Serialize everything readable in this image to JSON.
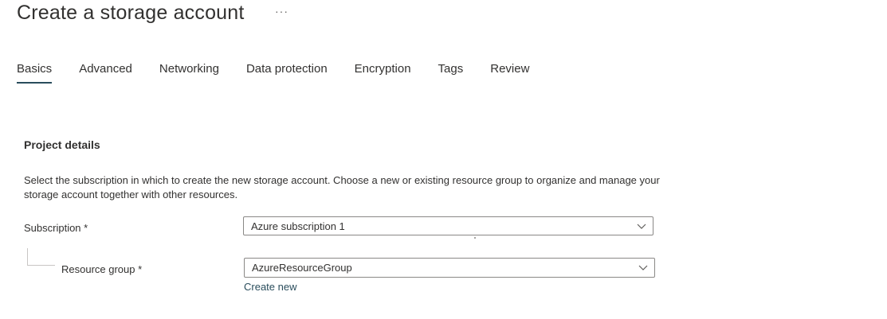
{
  "page": {
    "title": "Create a storage account",
    "more_label": "···"
  },
  "tabs": [
    {
      "label": "Basics",
      "active": true
    },
    {
      "label": "Advanced",
      "active": false
    },
    {
      "label": "Networking",
      "active": false
    },
    {
      "label": "Data protection",
      "active": false
    },
    {
      "label": "Encryption",
      "active": false
    },
    {
      "label": "Tags",
      "active": false
    },
    {
      "label": "Review",
      "active": false
    }
  ],
  "project_details": {
    "heading": "Project details",
    "description": "Select the subscription in which to create the new storage account. Choose a new or existing resource group to organize and manage your storage account together with other resources.",
    "subscription": {
      "label": "Subscription *",
      "value": "Azure subscription 1",
      "icon": "chevron-down-icon"
    },
    "resource_group": {
      "label": "Resource group *",
      "value": "AzureResourceGroup",
      "icon": "chevron-down-icon",
      "create_new_label": "Create new"
    }
  },
  "colors": {
    "accent": "#2a4d5c",
    "text": "#323130",
    "border": "#8a8886"
  }
}
